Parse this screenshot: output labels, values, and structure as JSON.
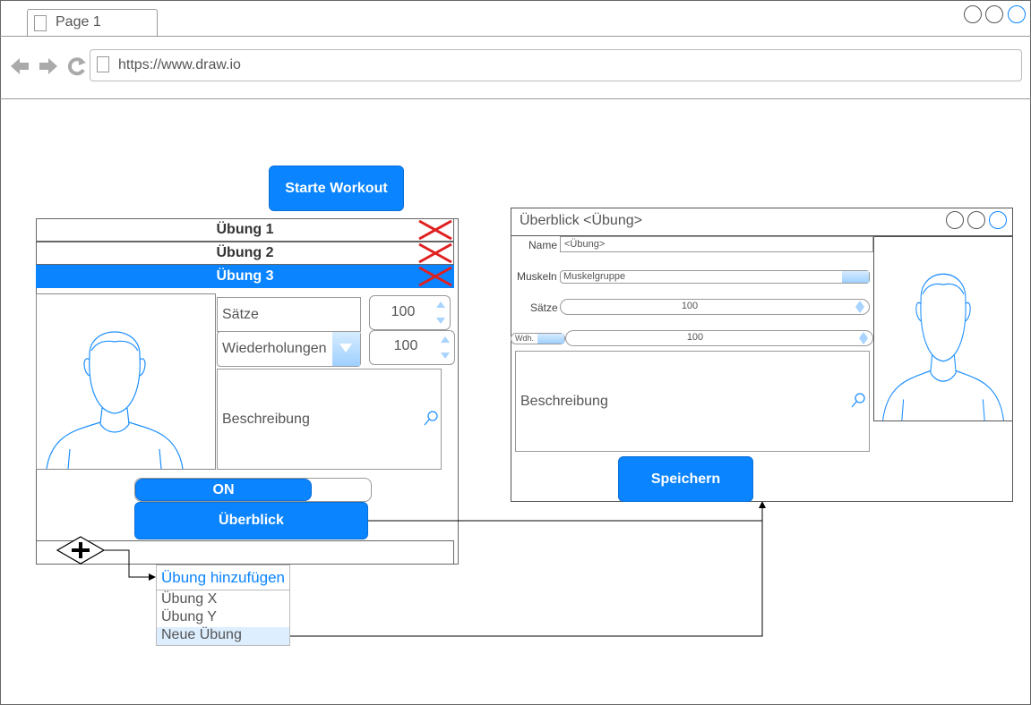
{
  "browser": {
    "tab_label": "Page 1",
    "url": "https://www.draw.io"
  },
  "workout": {
    "start_button": "Starte Workout",
    "exercises": [
      {
        "label": "Übung 1",
        "selected": false
      },
      {
        "label": "Übung 2",
        "selected": false
      },
      {
        "label": "Übung 3",
        "selected": true
      }
    ],
    "sets_label": "Sätze",
    "sets_value": "100",
    "reps_label": "Wiederholungen",
    "reps_value": "100",
    "description_label": "Beschreibung",
    "toggle_label": "ON",
    "overview_button": "Überblick"
  },
  "add_menu": {
    "header": "Übung hinzufügen",
    "items": [
      "Übung X",
      "Übung Y",
      "Neue Übung"
    ]
  },
  "overview_window": {
    "title": "Überblick <Übung>",
    "name_label": "Name",
    "name_value": "<Übung>",
    "muscles_label": "Muskeln",
    "muscles_value": "Muskelgruppe",
    "sets_label": "Sätze",
    "sets_value": "100",
    "reps_select": "Wdh.",
    "reps_value": "100",
    "description_label": "Beschreibung",
    "save_button": "Speichern"
  },
  "colors": {
    "accent": "#0a84ff",
    "delete": "#e02020"
  }
}
